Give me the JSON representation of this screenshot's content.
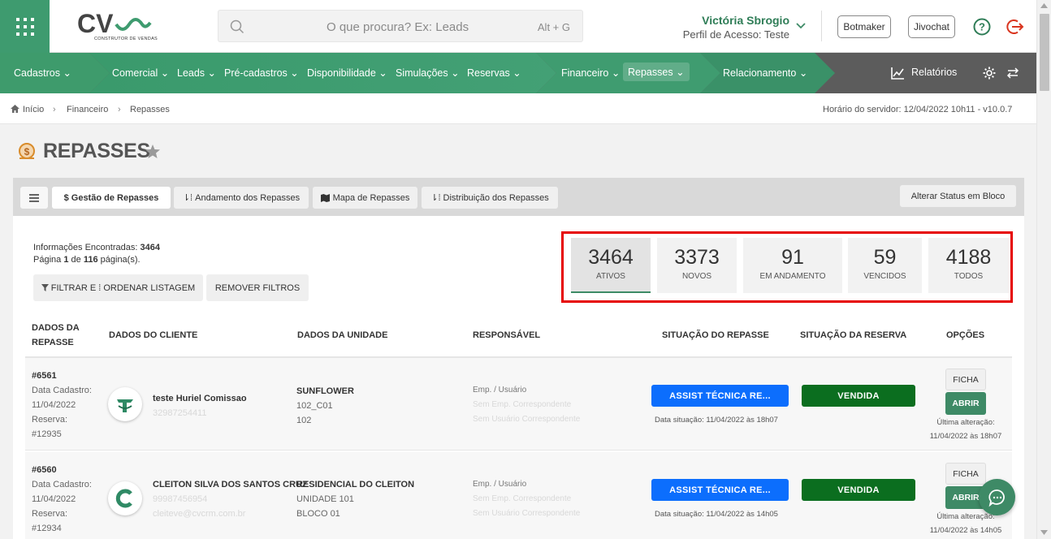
{
  "header": {
    "logo_text": "CV",
    "logo_subtext": "CONSTRUTOR DE VENDAS",
    "search_placeholder": "O que procura? Ex: Leads",
    "search_shortcut": "Alt + G",
    "user_name": "Victória Sbrogio",
    "user_profile": "Perfil de Acesso: Teste",
    "botmaker_label": "Botmaker",
    "jivochat_label": "Jivochat",
    "brand_color": "#3e9b6f"
  },
  "nav": {
    "cadastros": "Cadastros",
    "comercial": "Comercial",
    "leads": "Leads",
    "pre_cadastros": "Pré-cadastros",
    "disponibilidade": "Disponibilidade",
    "simulacoes": "Simulações",
    "reservas": "Reservas",
    "financeiro": "Financeiro",
    "repasses": "Repasses",
    "relacionamento": "Relacionamento",
    "relatorios": "Relatórios"
  },
  "breadcrumb": {
    "home": "Início",
    "financeiro": "Financeiro",
    "repasses": "Repasses",
    "server_time": "Horário do servidor: 12/04/2022 10h11 - v10.0.7"
  },
  "page": {
    "title": "REPASSES"
  },
  "tabs": {
    "gestao": "$ Gestão de Repasses",
    "andamento": "Andamento dos Repasses",
    "mapa": "Mapa de Repasses",
    "distribuicao": "Distribuição dos Repasses",
    "alterar_status": "Alterar Status em Bloco"
  },
  "info": {
    "found_label": "Informações Encontradas:",
    "found_value": "3464",
    "page_prefix": "Página",
    "page_current": "1",
    "page_of": "de",
    "page_total": "116",
    "page_suffix": "página(s)."
  },
  "filters": {
    "filter_button": "FILTRAR E ⁞ ORDENAR LISTAGEM",
    "remove_button": "REMOVER FILTROS"
  },
  "stats": [
    {
      "value": "3464",
      "label": "ATIVOS"
    },
    {
      "value": "3373",
      "label": "NOVOS"
    },
    {
      "value": "91",
      "label": "EM ANDAMENTO"
    },
    {
      "value": "59",
      "label": "VENCIDOS"
    },
    {
      "value": "4188",
      "label": "TODOS"
    }
  ],
  "table": {
    "headers": {
      "repasse_1": "DADOS DA",
      "repasse_2": "REPASSE",
      "cliente": "DADOS DO CLIENTE",
      "unidade": "DADOS DA UNIDADE",
      "responsavel": "RESPONSÁVEL",
      "situacao_repasse": "SITUAÇÃO DO REPASSE",
      "situacao_reserva": "SITUAÇÃO DA RESERVA",
      "opcoes": "OPÇÕES"
    },
    "rows": [
      {
        "id": "#6561",
        "cadastro_label": "Data Cadastro:",
        "cadastro_date": "11/04/2022",
        "reserva_label": "Reserva:",
        "reserva_id": "#12935",
        "client_name": "teste Huriel Comissao",
        "client_line2": "32987254411",
        "client_line3": "",
        "unit_name": "SUNFLOWER",
        "unit_line2": "102_C01",
        "unit_line3": "102",
        "resp_line1": "Emp. / Usuário",
        "resp_line2": "Sem Emp. Correspondente",
        "resp_line3": "Sem Usuário Correspondente",
        "repasse_status": "ASSIST TÉCNICA RE...",
        "repasse_date": "Data situação: 11/04/2022 às 18h07",
        "reserva_status": "VENDIDA",
        "ficha": "FICHA",
        "abrir": "ABRIR",
        "alt_label": "Última alteração:",
        "alt_date": "11/04/2022 às 18h07"
      },
      {
        "id": "#6560",
        "cadastro_label": "Data Cadastro:",
        "cadastro_date": "11/04/2022",
        "reserva_label": "Reserva:",
        "reserva_id": "#12934",
        "client_name": "CLEITON SILVA DOS SANTOS CRUZ",
        "client_line2": "99987456954",
        "client_line3": "cleiteve@cvcrm.com.br",
        "unit_name": "RESIDENCIAL DO CLEITON",
        "unit_line2": "UNIDADE 101",
        "unit_line3": "BLOCO 01",
        "resp_line1": "Emp. / Usuário",
        "resp_line2": "Sem Emp. Correspondente",
        "resp_line3": "Sem Usuário Correspondente",
        "repasse_status": "ASSIST TÉCNICA RE...",
        "repasse_date": "Data situação: 11/04/2022 às 14h05",
        "reserva_status": "VENDIDA",
        "ficha": "FICHA",
        "abrir": "ABRIR",
        "alt_label": "Última alteração:",
        "alt_date": "11/04/2022 às 14h05"
      }
    ]
  },
  "colors": {
    "status_blue": "#0c6efd",
    "status_green": "#0b6e1f",
    "highlight_red": "#e60000"
  }
}
